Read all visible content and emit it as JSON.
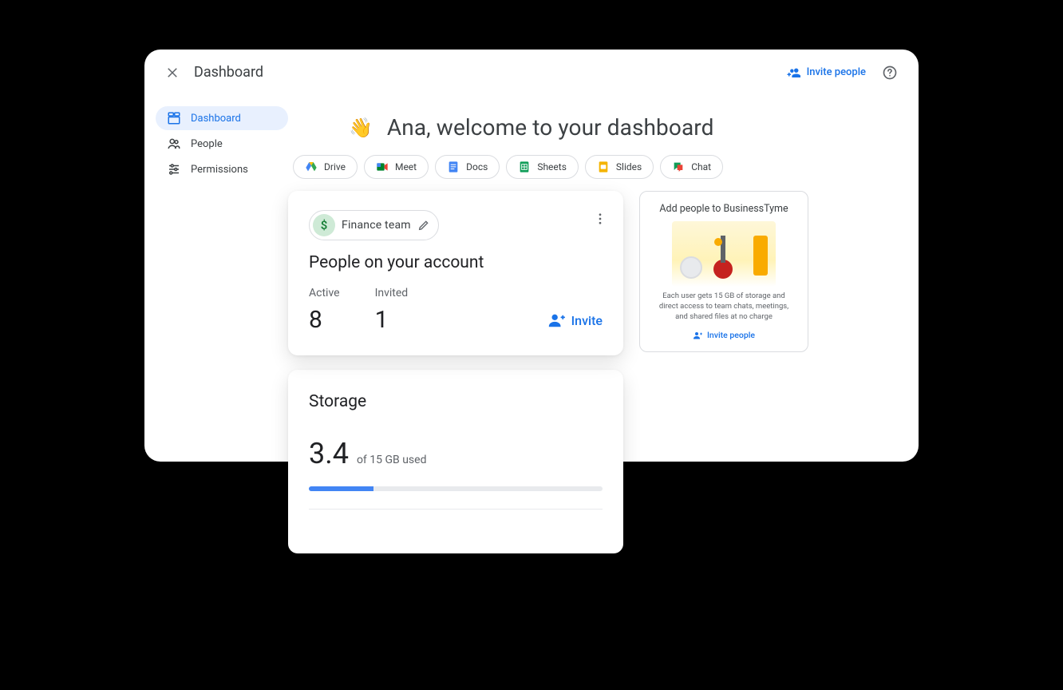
{
  "topbar": {
    "title": "Dashboard",
    "invite_label": "Invite people"
  },
  "sidebar": {
    "items": [
      {
        "label": "Dashboard"
      },
      {
        "label": "People"
      },
      {
        "label": "Permissions"
      }
    ]
  },
  "hero": {
    "emoji": "👋",
    "title": "Ana, welcome to your dashboard"
  },
  "chips": [
    {
      "label": "Drive"
    },
    {
      "label": "Meet"
    },
    {
      "label": "Docs"
    },
    {
      "label": "Sheets"
    },
    {
      "label": "Slides"
    },
    {
      "label": "Chat"
    }
  ],
  "people_card": {
    "team_name": "Finance team",
    "title": "People on your account",
    "active_label": "Active",
    "active_value": "8",
    "invited_label": "Invited",
    "invited_value": "1",
    "invite_cta": "Invite"
  },
  "storage_card": {
    "title": "Storage",
    "value": "3.4",
    "suffix": "of 15 GB used",
    "progress_percent": 22
  },
  "promo": {
    "title": "Add people to BusinessTyme",
    "blurb": "Each user gets 15 GB of storage and direct access to team chats, meetings, and shared files at no charge",
    "cta": "Invite people"
  }
}
